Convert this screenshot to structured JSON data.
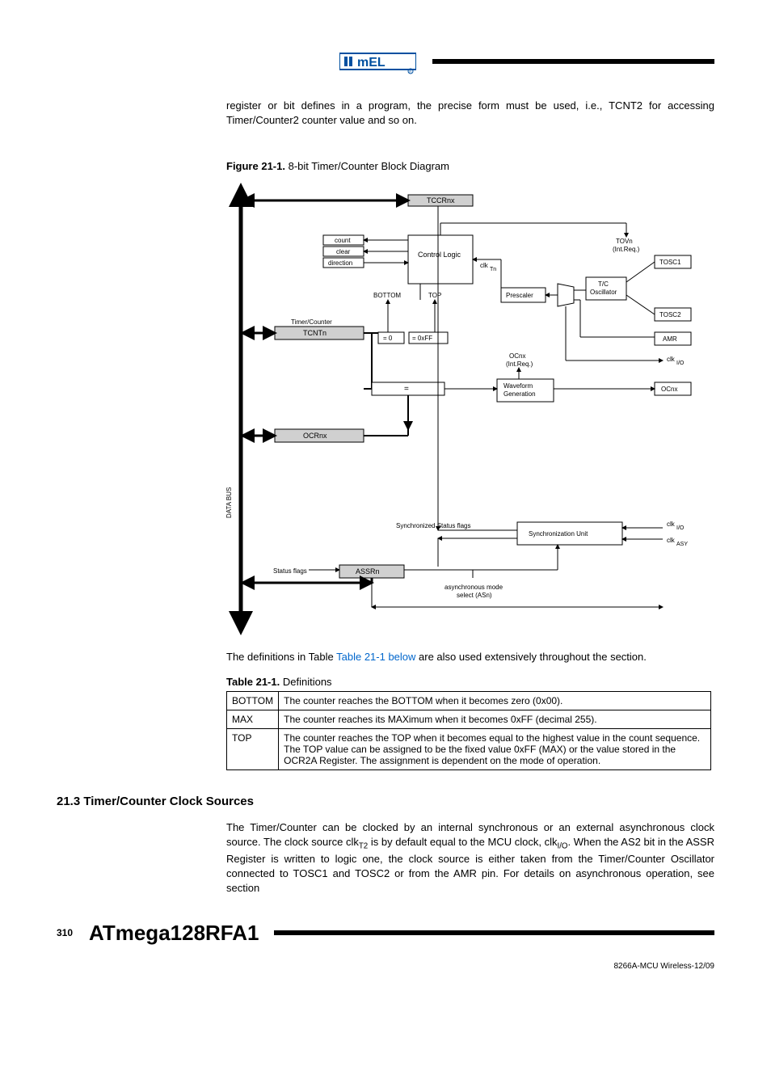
{
  "header": {
    "logo_alt": "Atmel"
  },
  "intro_para": "register or bit defines in a program, the precise form must be used, i.e., TCNT2 for accessing Timer/Counter2 counter value and so on.",
  "figure": {
    "caption_label": "Figure 21-1.",
    "caption_text": "8-bit Timer/Counter Block Diagram",
    "labels": {
      "tccrnx": "TCCRnx",
      "count": "count",
      "clear": "clear",
      "direction": "direction",
      "control_logic": "Control Logic",
      "clk_tn": "clk",
      "clk_tn_sub": "Tn",
      "tovn": "TOVn",
      "tovn_sub": "(Int.Req.)",
      "tosc1": "TOSC1",
      "bottom": "BOTTOM",
      "top": "TOP",
      "prescaler": "Prescaler",
      "tc_osc": "T/C",
      "tc_osc2": "Oscillator",
      "tosc2": "TOSC2",
      "timer_counter": "Timer/Counter",
      "tcntn": "TCNTn",
      "eq0": "= 0",
      "eq0xff": "= 0xFF",
      "amr": "AMR",
      "ocnx": "OCnx",
      "ocnx_sub": "(Int.Req.)",
      "clk_io": "clk",
      "clk_io_sub": "I/O",
      "eq": "=",
      "waveform": "Waveform",
      "generation": "Generation",
      "ocnx_out": "OCnx",
      "ocrnx": "OCRnx",
      "data_bus": "DATA BUS",
      "sync_flags": "Synchronized Status flags",
      "sync_unit": "Synchronization Unit",
      "clk_io2": "clk",
      "clk_io2_sub": "I/O",
      "clk_asy": "clk",
      "clk_asy_sub": "ASY",
      "status_flags": "Status flags",
      "assrn": "ASSRn",
      "async_mode": "asynchronous mode",
      "async_select": "select (ASn)"
    }
  },
  "after_figure": {
    "pre": "The definitions in Table ",
    "link": "Table 21-1 below",
    "post": " are also used extensively throughout the section."
  },
  "table": {
    "caption_label": "Table 21-1.",
    "caption_text": "Definitions",
    "rows": [
      {
        "term": "BOTTOM",
        "def": "The counter reaches the BOTTOM when it becomes zero (0x00)."
      },
      {
        "term": "MAX",
        "def": "The counter reaches its MAXimum when it becomes 0xFF (decimal 255)."
      },
      {
        "term": "TOP",
        "def": "The counter reaches the TOP when it becomes equal to the highest value in the count sequence. The TOP value can be assigned to be the fixed value 0xFF (MAX) or the value stored in the OCR2A Register. The assignment is dependent on the mode of operation."
      }
    ]
  },
  "section": {
    "number": "21.3",
    "title": "Timer/Counter Clock Sources",
    "para_pre": "The Timer/Counter can be clocked by an internal synchronous or an external asynchronous clock source. The clock source clk",
    "para_sub1": "T2",
    "para_mid": " is by default equal to the MCU clock, clk",
    "para_sub2": "I/O",
    "para_post": ". When the AS2 bit in the ASSR Register is written to logic one, the clock source is either taken from the Timer/Counter Oscillator connected to TOSC1 and TOSC2 or from the AMR pin. For details on asynchronous operation, see section"
  },
  "footer": {
    "page_num": "310",
    "doc_title": "ATmega128RFA1",
    "doc_id": "8266A-MCU Wireless-12/09"
  }
}
